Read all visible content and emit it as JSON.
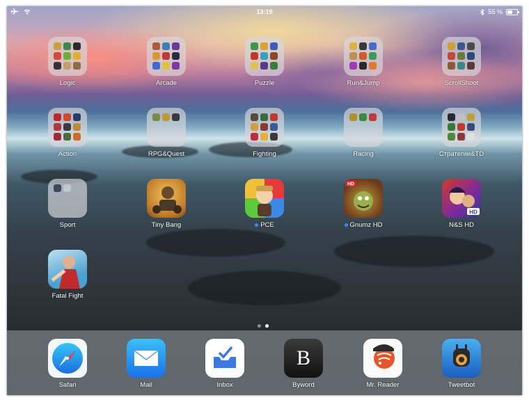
{
  "status_bar": {
    "time": "13:19",
    "battery_percent": "55 %",
    "battery_level": 0.55,
    "left_icons": [
      "airplane-mode-icon",
      "wifi-icon"
    ],
    "right_icons": [
      "bluetooth-icon",
      "battery-icon"
    ]
  },
  "folders": [
    {
      "label": "Logic"
    },
    {
      "label": "Arcade"
    },
    {
      "label": "Puzzle"
    },
    {
      "label": "Run&Jump"
    },
    {
      "label": "ScrollShoot"
    },
    {
      "label": "Action"
    },
    {
      "label": "RPG&Quest"
    },
    {
      "label": "Fighting"
    },
    {
      "label": "Racing"
    },
    {
      "label": "Стратегии&TD"
    },
    {
      "label": "Sport"
    }
  ],
  "apps": [
    {
      "label": "Tiny Bang",
      "badge_dot": false
    },
    {
      "label": "PCE",
      "badge_dot": true
    },
    {
      "label": "Gnumz HD",
      "badge_dot": true
    },
    {
      "label": "N&S HD",
      "badge_dot": false
    },
    {
      "label": "Fatal Fight",
      "badge_dot": false
    }
  ],
  "page_indicator": {
    "pages": 2,
    "current": 2
  },
  "dock": [
    {
      "label": "Safari"
    },
    {
      "label": "Mail"
    },
    {
      "label": "Inbox"
    },
    {
      "label": "Byword",
      "glyph": "B"
    },
    {
      "label": "Mr. Reader"
    },
    {
      "label": "Tweetbot"
    }
  ]
}
